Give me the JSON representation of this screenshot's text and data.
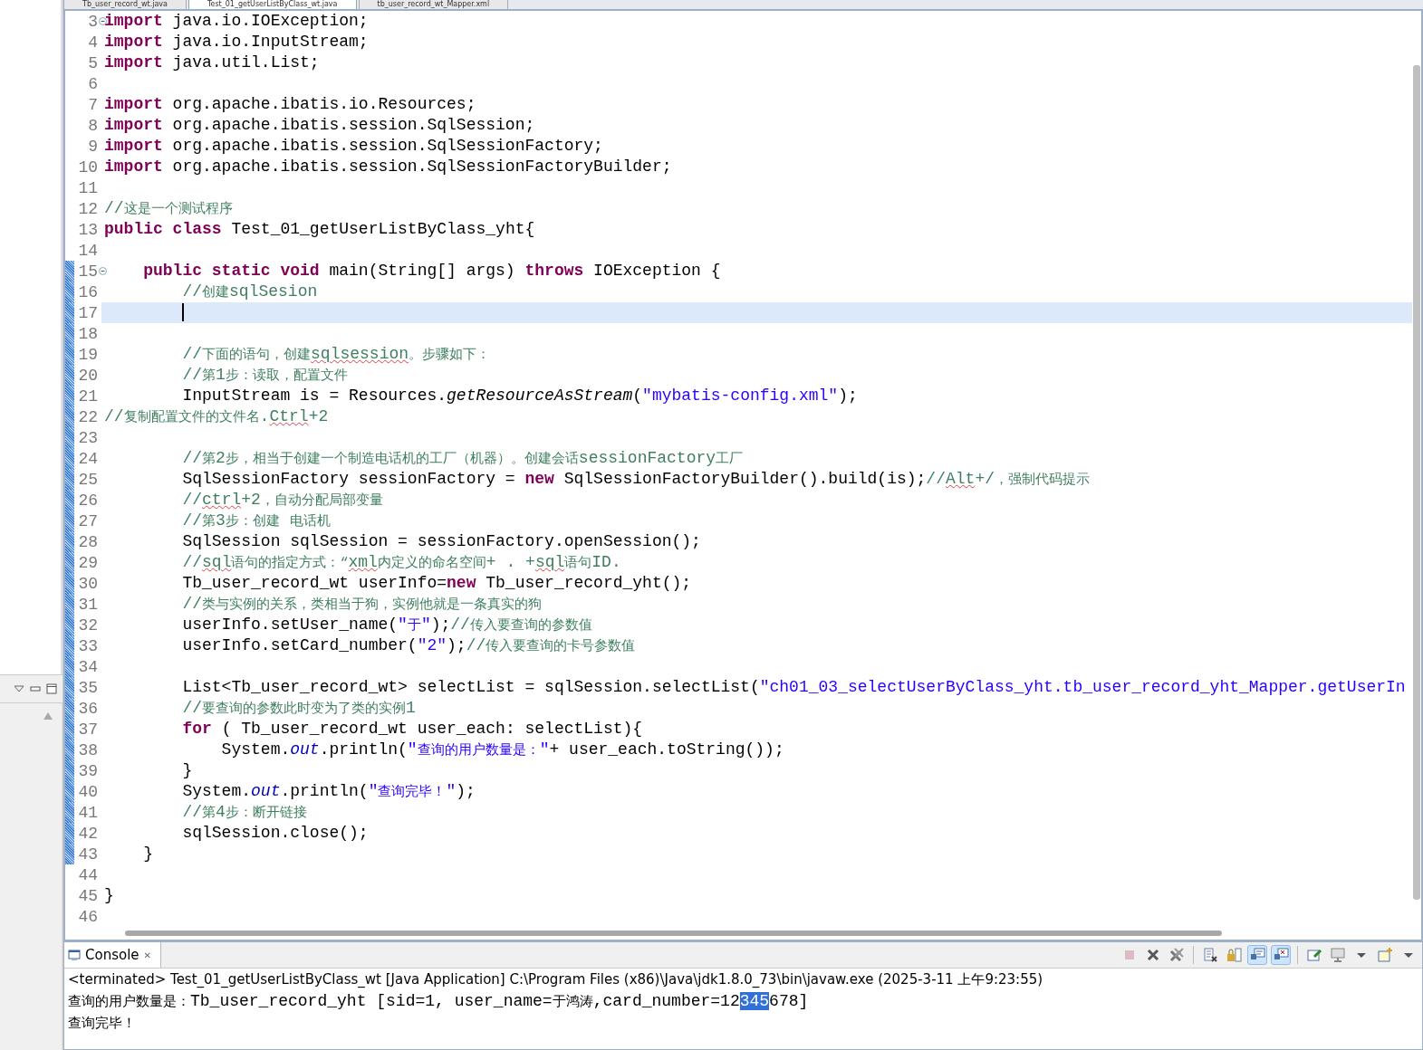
{
  "editor_tabs": [
    {
      "label": "Tb_user_record_wt.java",
      "selected": false
    },
    {
      "label": "Test_01_getUserListByClass_wt.java",
      "selected": true
    },
    {
      "label": "tb_user_record_wt_Mapper.xml",
      "selected": false
    }
  ],
  "code_lines": [
    {
      "num": "3",
      "fold": true,
      "changed": false,
      "current": false,
      "tokens": [
        {
          "kind": "kw",
          "text": "import"
        },
        {
          "kind": "plain",
          "text": " java.io.IOException;"
        }
      ]
    },
    {
      "num": "4",
      "fold": false,
      "changed": false,
      "current": false,
      "tokens": [
        {
          "kind": "kw",
          "text": "import"
        },
        {
          "kind": "plain",
          "text": " java.io.InputStream;"
        }
      ]
    },
    {
      "num": "5",
      "fold": false,
      "changed": false,
      "current": false,
      "tokens": [
        {
          "kind": "kw",
          "text": "import"
        },
        {
          "kind": "plain",
          "text": " java.util.List;"
        }
      ]
    },
    {
      "num": "6",
      "fold": false,
      "changed": false,
      "current": false
    },
    {
      "num": "7",
      "fold": false,
      "changed": false,
      "current": false,
      "tokens": [
        {
          "kind": "kw",
          "text": "import"
        },
        {
          "kind": "plain",
          "text": " org.apache.ibatis.io.Resources;"
        }
      ]
    },
    {
      "num": "8",
      "fold": false,
      "changed": false,
      "current": false,
      "tokens": [
        {
          "kind": "kw",
          "text": "import"
        },
        {
          "kind": "plain",
          "text": " org.apache.ibatis.session.SqlSession;"
        }
      ]
    },
    {
      "num": "9",
      "fold": false,
      "changed": false,
      "current": false,
      "tokens": [
        {
          "kind": "kw",
          "text": "import"
        },
        {
          "kind": "plain",
          "text": " org.apache.ibatis.session.SqlSessionFactory;"
        }
      ]
    },
    {
      "num": "10",
      "fold": false,
      "changed": false,
      "current": false,
      "tokens": [
        {
          "kind": "kw",
          "text": "import"
        },
        {
          "kind": "plain",
          "text": " org.apache.ibatis.session.SqlSessionFactoryBuilder;"
        }
      ]
    },
    {
      "num": "11",
      "fold": false,
      "changed": false,
      "current": false
    },
    {
      "num": "12",
      "fold": false,
      "changed": false,
      "current": false,
      "tokens": [
        {
          "kind": "com",
          "text": "//这是一个测试程序"
        }
      ]
    },
    {
      "num": "13",
      "fold": false,
      "changed": false,
      "current": false,
      "tokens": [
        {
          "kind": "kw",
          "text": "public class"
        },
        {
          "kind": "plain",
          "text": " Test_01_getUserListByClass_yht{"
        }
      ]
    },
    {
      "num": "14",
      "fold": false,
      "changed": false,
      "current": false
    },
    {
      "num": "15",
      "fold": true,
      "changed": true,
      "current": false,
      "tokens": [
        {
          "kind": "kw",
          "text": "    public static void"
        },
        {
          "kind": "plain",
          "text": " main(String[] args) "
        },
        {
          "kind": "kw",
          "text": "throws"
        },
        {
          "kind": "plain",
          "text": " IOException {"
        }
      ]
    },
    {
      "num": "16",
      "fold": false,
      "changed": true,
      "current": false,
      "tokens": [
        {
          "kind": "com",
          "text": "        //创建sqlSesion"
        }
      ]
    },
    {
      "num": "17",
      "fold": false,
      "changed": true,
      "current": true
    },
    {
      "num": "18",
      "fold": false,
      "changed": true,
      "current": false
    },
    {
      "num": "19",
      "fold": false,
      "changed": true,
      "current": false,
      "tokens": [
        {
          "kind": "com",
          "text": "        //下面的语句，创建"
        },
        {
          "kind": "com",
          "text": "sqlsession",
          "misspelled": true
        },
        {
          "kind": "com",
          "text": "。步骤如下："
        }
      ]
    },
    {
      "num": "20",
      "fold": false,
      "changed": true,
      "current": false,
      "tokens": [
        {
          "kind": "com",
          "text": "        //第1步：读取，配置文件"
        }
      ]
    },
    {
      "num": "21",
      "fold": false,
      "changed": true,
      "current": false,
      "tokens": [
        {
          "kind": "plain",
          "text": "        InputStream is = Resources."
        },
        {
          "kind": "static-method",
          "text": "getResourceAsStream"
        },
        {
          "kind": "plain",
          "text": "("
        },
        {
          "kind": "str",
          "text": "\"mybatis-config.xml\""
        },
        {
          "kind": "plain",
          "text": ");"
        }
      ]
    },
    {
      "num": "22",
      "fold": false,
      "changed": true,
      "current": false,
      "tokens": [
        {
          "kind": "com",
          "text": "//复制配置文件的文件名."
        },
        {
          "kind": "com",
          "text": "Ctrl",
          "misspelled": true
        },
        {
          "kind": "com",
          "text": "+2"
        }
      ]
    },
    {
      "num": "23",
      "fold": false,
      "changed": true,
      "current": false
    },
    {
      "num": "24",
      "fold": false,
      "changed": true,
      "current": false,
      "tokens": [
        {
          "kind": "com",
          "text": "        //第2步，相当于创建一个制造电话机的工厂（机器）。创建会话sessionFactory工厂"
        }
      ]
    },
    {
      "num": "25",
      "fold": false,
      "changed": true,
      "current": false,
      "tokens": [
        {
          "kind": "plain",
          "text": "        SqlSessionFactory sessionFactory = "
        },
        {
          "kind": "kw",
          "text": "new"
        },
        {
          "kind": "plain",
          "text": " SqlSessionFactoryBuilder().build(is);"
        },
        {
          "kind": "com",
          "text": "//"
        },
        {
          "kind": "com",
          "text": "Alt",
          "misspelled": true
        },
        {
          "kind": "com",
          "text": "+/，强制代码提示"
        }
      ]
    },
    {
      "num": "26",
      "fold": false,
      "changed": true,
      "current": false,
      "tokens": [
        {
          "kind": "com",
          "text": "        //"
        },
        {
          "kind": "com",
          "text": "ctrl",
          "misspelled": true
        },
        {
          "kind": "com",
          "text": "+2，自动分配局部变量"
        }
      ]
    },
    {
      "num": "27",
      "fold": false,
      "changed": true,
      "current": false,
      "tokens": [
        {
          "kind": "com",
          "text": "        //第3步：创建 电话机"
        }
      ]
    },
    {
      "num": "28",
      "fold": false,
      "changed": true,
      "current": false,
      "tokens": [
        {
          "kind": "plain",
          "text": "        SqlSession sqlSession = sessionFactory.openSession();"
        }
      ]
    },
    {
      "num": "29",
      "fold": false,
      "changed": true,
      "current": false,
      "tokens": [
        {
          "kind": "com",
          "text": "        //"
        },
        {
          "kind": "com",
          "text": "sql",
          "misspelled": true
        },
        {
          "kind": "com",
          "text": "语句的指定方式：“"
        },
        {
          "kind": "com",
          "text": "xml",
          "misspelled": true
        },
        {
          "kind": "com",
          "text": "内定义的命名空间+ . +"
        },
        {
          "kind": "com",
          "text": "sql",
          "misspelled": true
        },
        {
          "kind": "com",
          "text": "语句ID."
        }
      ]
    },
    {
      "num": "30",
      "fold": false,
      "changed": true,
      "current": false,
      "tokens": [
        {
          "kind": "plain",
          "text": "        Tb_user_record_wt userInfo="
        },
        {
          "kind": "kw",
          "text": "new"
        },
        {
          "kind": "plain",
          "text": " Tb_user_record_yht();"
        }
      ]
    },
    {
      "num": "31",
      "fold": false,
      "changed": true,
      "current": false,
      "tokens": [
        {
          "kind": "com",
          "text": "        //类与实例的关系，类相当于狗，实例他就是一条真实的狗"
        }
      ]
    },
    {
      "num": "32",
      "fold": false,
      "changed": true,
      "current": false,
      "tokens": [
        {
          "kind": "plain",
          "text": "        userInfo.setUser_name("
        },
        {
          "kind": "str",
          "text": "\"于\""
        },
        {
          "kind": "plain",
          "text": ");"
        },
        {
          "kind": "com",
          "text": "//传入要查询的参数值"
        }
      ]
    },
    {
      "num": "33",
      "fold": false,
      "changed": true,
      "current": false,
      "tokens": [
        {
          "kind": "plain",
          "text": "        userInfo.setCard_number("
        },
        {
          "kind": "str",
          "text": "\"2\""
        },
        {
          "kind": "plain",
          "text": ");"
        },
        {
          "kind": "com",
          "text": "//传入要查询的卡号参数值"
        }
      ]
    },
    {
      "num": "34",
      "fold": false,
      "changed": true,
      "current": false
    },
    {
      "num": "35",
      "fold": false,
      "changed": true,
      "current": false,
      "tokens": [
        {
          "kind": "plain",
          "text": "        List<Tb_user_record_wt> selectList = sqlSession.selectList("
        },
        {
          "kind": "str",
          "text": "\"ch01_03_selectUserByClass_yht.tb_user_record_yht_Mapper.getUserIn"
        }
      ]
    },
    {
      "num": "36",
      "fold": false,
      "changed": true,
      "current": false,
      "tokens": [
        {
          "kind": "com",
          "text": "        //要查询的参数此时变为了类的实例1"
        }
      ]
    },
    {
      "num": "37",
      "fold": false,
      "changed": true,
      "current": false,
      "tokens": [
        {
          "kind": "kw",
          "text": "        for"
        },
        {
          "kind": "plain",
          "text": " ( Tb_user_record_wt user_each: selectList){"
        }
      ]
    },
    {
      "num": "38",
      "fold": false,
      "changed": true,
      "current": false,
      "tokens": [
        {
          "kind": "plain",
          "text": "            System."
        },
        {
          "kind": "static-field",
          "text": "out"
        },
        {
          "kind": "plain",
          "text": ".println("
        },
        {
          "kind": "str",
          "text": "\"查询的用户数量是：\""
        },
        {
          "kind": "plain",
          "text": "+ user_each.toString());"
        }
      ]
    },
    {
      "num": "39",
      "fold": false,
      "changed": true,
      "current": false,
      "tokens": [
        {
          "kind": "plain",
          "text": "        }"
        }
      ]
    },
    {
      "num": "40",
      "fold": false,
      "changed": true,
      "current": false,
      "tokens": [
        {
          "kind": "plain",
          "text": "        System."
        },
        {
          "kind": "static-field",
          "text": "out"
        },
        {
          "kind": "plain",
          "text": ".println("
        },
        {
          "kind": "str",
          "text": "\"查询完毕！\""
        },
        {
          "kind": "plain",
          "text": ");"
        }
      ]
    },
    {
      "num": "41",
      "fold": false,
      "changed": true,
      "current": false,
      "tokens": [
        {
          "kind": "com",
          "text": "        //第4步：断开链接"
        }
      ]
    },
    {
      "num": "42",
      "fold": false,
      "changed": true,
      "current": false,
      "tokens": [
        {
          "kind": "plain",
          "text": "        sqlSession.close();"
        }
      ]
    },
    {
      "num": "43",
      "fold": false,
      "changed": true,
      "current": false,
      "tokens": [
        {
          "kind": "plain",
          "text": "    }"
        }
      ]
    },
    {
      "num": "44",
      "fold": false,
      "changed": false,
      "current": false
    },
    {
      "num": "45",
      "fold": false,
      "changed": false,
      "current": false,
      "tokens": [
        {
          "kind": "plain",
          "text": "}"
        }
      ]
    },
    {
      "num": "46",
      "fold": false,
      "changed": false,
      "current": false
    }
  ],
  "console": {
    "title": "Console",
    "close": "✕",
    "toolbar": [
      {
        "kind": "terminate",
        "disabled": true,
        "selected": false
      },
      {
        "kind": "remove",
        "disabled": false,
        "selected": false
      },
      {
        "kind": "remove-all",
        "disabled": false,
        "selected": false
      },
      {
        "kind": "sep"
      },
      {
        "kind": "clear",
        "disabled": false,
        "selected": false
      },
      {
        "kind": "scroll-lock",
        "disabled": false,
        "selected": false
      },
      {
        "kind": "stdout",
        "disabled": false,
        "selected": true
      },
      {
        "kind": "stderr",
        "disabled": false,
        "selected": true
      },
      {
        "kind": "sep"
      },
      {
        "kind": "pin",
        "disabled": false,
        "selected": false
      },
      {
        "kind": "display",
        "disabled": false,
        "selected": false
      },
      {
        "kind": "dropdown",
        "disabled": false,
        "selected": false
      },
      {
        "kind": "new-console",
        "disabled": false,
        "selected": false
      },
      {
        "kind": "dropdown",
        "disabled": false,
        "selected": false
      }
    ],
    "status": "<terminated> Test_01_getUserListByClass_wt [Java Application] C:\\Program Files (x86)\\Java\\jdk1.8.0_73\\bin\\javaw.exe (2025-3-11 上午9:23:55)",
    "output": [
      {
        "segments": [
          {
            "text": "查询的用户数量是：Tb_user_record_yht [sid=1, user_name=于鸿涛,card_number=12",
            "selected": false
          },
          {
            "text": "345",
            "selected": true
          },
          {
            "text": "678]",
            "selected": false
          }
        ]
      },
      {
        "segments": [
          {
            "text": "查询完毕！",
            "selected": false
          }
        ]
      }
    ]
  }
}
